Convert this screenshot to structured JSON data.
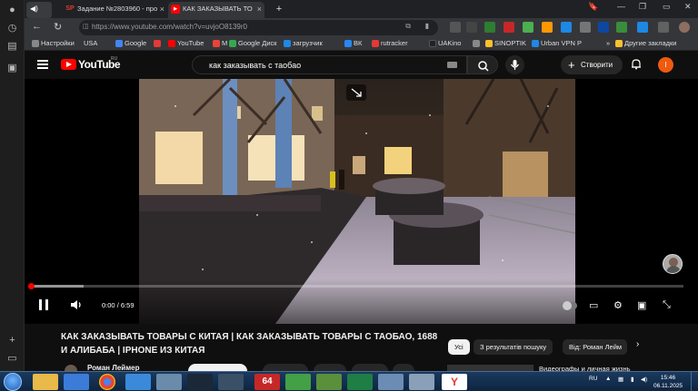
{
  "browser": {
    "tabs": [
      {
        "label": "Задание №2803960 - про",
        "favicon": "SP",
        "color": "#e53935",
        "active": false
      },
      {
        "label": "КАК ЗАКАЗЫВАТЬ ТО",
        "favicon": "▶",
        "color": "#ff0000",
        "active": true
      }
    ],
    "new_tab_label": "+",
    "url": "https://www.youtube.com/watch?v=uvjoO8139r0",
    "bookmarks": [
      {
        "label": "Настройки",
        "color": "#888"
      },
      {
        "label": "USA",
        "color": "#666"
      },
      {
        "label": "Google",
        "color": "#4285f4"
      },
      {
        "label": "",
        "color": "#e53935"
      },
      {
        "label": "YouTube",
        "color": "#ff0000"
      },
      {
        "label": "Gmail",
        "color": "#ea4335"
      },
      {
        "label": "Google Диск",
        "color": "#34a853"
      },
      {
        "label": "загрузчик",
        "color": "#1e88e5"
      },
      {
        "label": "ВК",
        "color": "#2787f5"
      },
      {
        "label": "rutracker",
        "color": "#e53935"
      },
      {
        "label": "UAKino",
        "color": "#222"
      },
      {
        "label": "",
        "color": "#888"
      },
      {
        "label": "SINOPTIK",
        "color": "#fbc02d"
      },
      {
        "label": "Urban VPN P",
        "color": "#1e88e5"
      }
    ],
    "other_bookmarks": "Другие закладки"
  },
  "youtube": {
    "logo_text": "YouTube",
    "country": "RU",
    "search_query": "как заказывать с таобао",
    "create_label": "Створити",
    "avatar_letter": "I",
    "player": {
      "time_current": "0:00",
      "time_total": "6:59",
      "time_separator": "/",
      "progress": 0,
      "buffered": 0.08
    },
    "video_title": "КАК ЗАКАЗЫВАТЬ ТОВАРЫ С КИТАЯ | КАК ЗАКАЗЫВАТЬ ТОВАРЫ С ТАОБАО, 1688 И АЛИБАБА | IPHONE ИЗ КИТАЯ",
    "channel_name": "Роман Леймер",
    "chips": [
      {
        "label": "Усі",
        "selected": true
      },
      {
        "label": "З результатів пошуку",
        "selected": false
      },
      {
        "label": "Від: Роман Лейм",
        "selected": false
      }
    ],
    "next_title": "Видеографы и личная жизнь"
  },
  "taskbar": {
    "apps": [
      {
        "name": "explorer",
        "color": "#e9b949"
      },
      {
        "name": "wps",
        "color": "#3d7bd8"
      },
      {
        "name": "chrome",
        "color": "#e8453c"
      },
      {
        "name": "ie",
        "color": "#3b8ad9"
      },
      {
        "name": "shield",
        "color": "#6a8caa"
      },
      {
        "name": "steam",
        "color": "#1b2838"
      },
      {
        "name": "aida64",
        "color": "#c62828"
      },
      {
        "name": "paint",
        "color": "#43a047"
      },
      {
        "name": "media",
        "color": "#5a8f3c"
      },
      {
        "name": "excel",
        "color": "#1e7e45"
      },
      {
        "name": "window",
        "color": "#6b8db5"
      },
      {
        "name": "tool",
        "color": "#8aa0b8"
      },
      {
        "name": "yandex",
        "color": "#ffffff"
      }
    ],
    "aida_label": "64",
    "language": "RU",
    "time": "15:46",
    "date": "06.11.2025"
  }
}
